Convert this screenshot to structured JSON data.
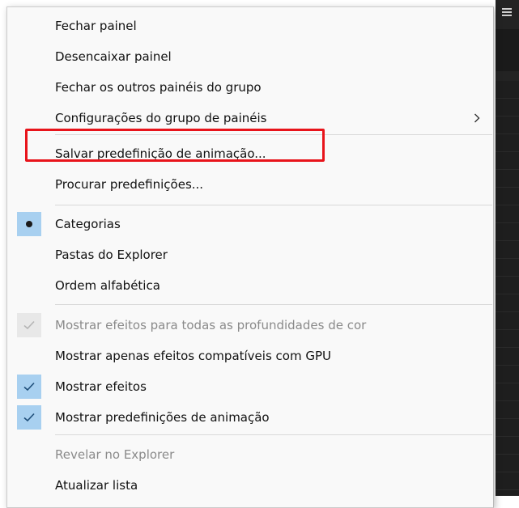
{
  "menu": {
    "items": [
      {
        "label": "Fechar painel"
      },
      {
        "label": "Desencaixar painel"
      },
      {
        "label": "Fechar os outros painéis do grupo"
      },
      {
        "label": "Configurações do grupo de painéis",
        "submenu": true
      },
      {
        "label": "Salvar predefinição de animação..."
      },
      {
        "label": "Procurar predefinições..."
      },
      {
        "label": "Categorias",
        "selected": true
      },
      {
        "label": "Pastas do Explorer"
      },
      {
        "label": "Ordem alfabética"
      },
      {
        "label": "Mostrar efeitos para todas as profundidades de cor",
        "checked": true,
        "disabled": true
      },
      {
        "label": "Mostrar apenas efeitos compatíveis com GPU"
      },
      {
        "label": "Mostrar efeitos",
        "checked": true
      },
      {
        "label": "Mostrar predefinições de animação",
        "checked": true
      },
      {
        "label": "Revelar no Explorer",
        "disabled": true
      },
      {
        "label": "Atualizar lista"
      }
    ]
  },
  "colors": {
    "highlight_border": "#e8141b",
    "check_background": "#a8d0f0",
    "disabled_text": "#8a8a8a"
  },
  "icons": {
    "submenu": "chevron-right-icon",
    "check": "checkmark-icon",
    "radio": "bullet-icon",
    "app_menu": "hamburger-icon"
  }
}
